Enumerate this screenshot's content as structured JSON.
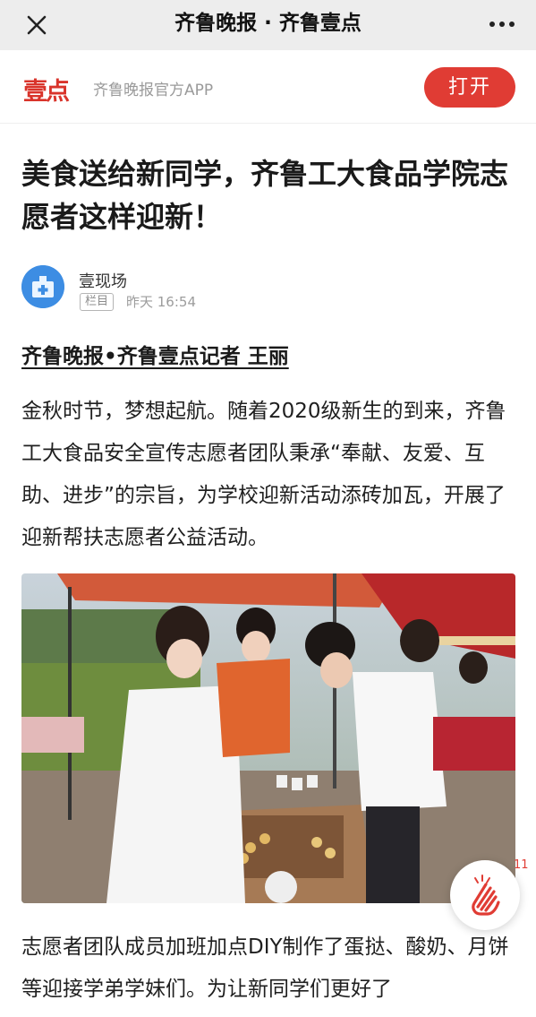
{
  "navbar": {
    "title": "齐鲁晚报 · 齐鲁壹点",
    "close_icon": "close-icon",
    "more_icon": "more-dots-icon"
  },
  "app_banner": {
    "logo_text": "壹点",
    "app_name": "齐鲁晚报官方APP",
    "open_button": "打开",
    "accent_color": "#e03c34"
  },
  "article": {
    "title": "美食送给新同学，齐鲁工大食品学院志愿者这样迎新！",
    "author": {
      "name": "壹现场",
      "tag": "栏目",
      "time": "昨天 16:54",
      "avatar_icon": "hospital-cross-avatar-icon"
    },
    "byline": "齐鲁晚报•齐鲁壹点记者  王丽",
    "paragraphs": [
      "金秋时节，梦想起航。随着2020级新生的到来，齐鲁工大食品安全宣传志愿者团队秉承“奉献、友爱、互助、进步”的宗旨，为学校迎新活动添砖加瓦，开展了迎新帮扶志愿者公益活动。",
      "志愿者团队成员加班加点DIY制作了蛋挞、酸奶、月饼等迎接学弟学妹们。为让新同学们更好了"
    ],
    "photo_icon": "volunteers-food-stall-photo"
  },
  "clap": {
    "icon": "clapping-hands-icon",
    "count": "11"
  }
}
